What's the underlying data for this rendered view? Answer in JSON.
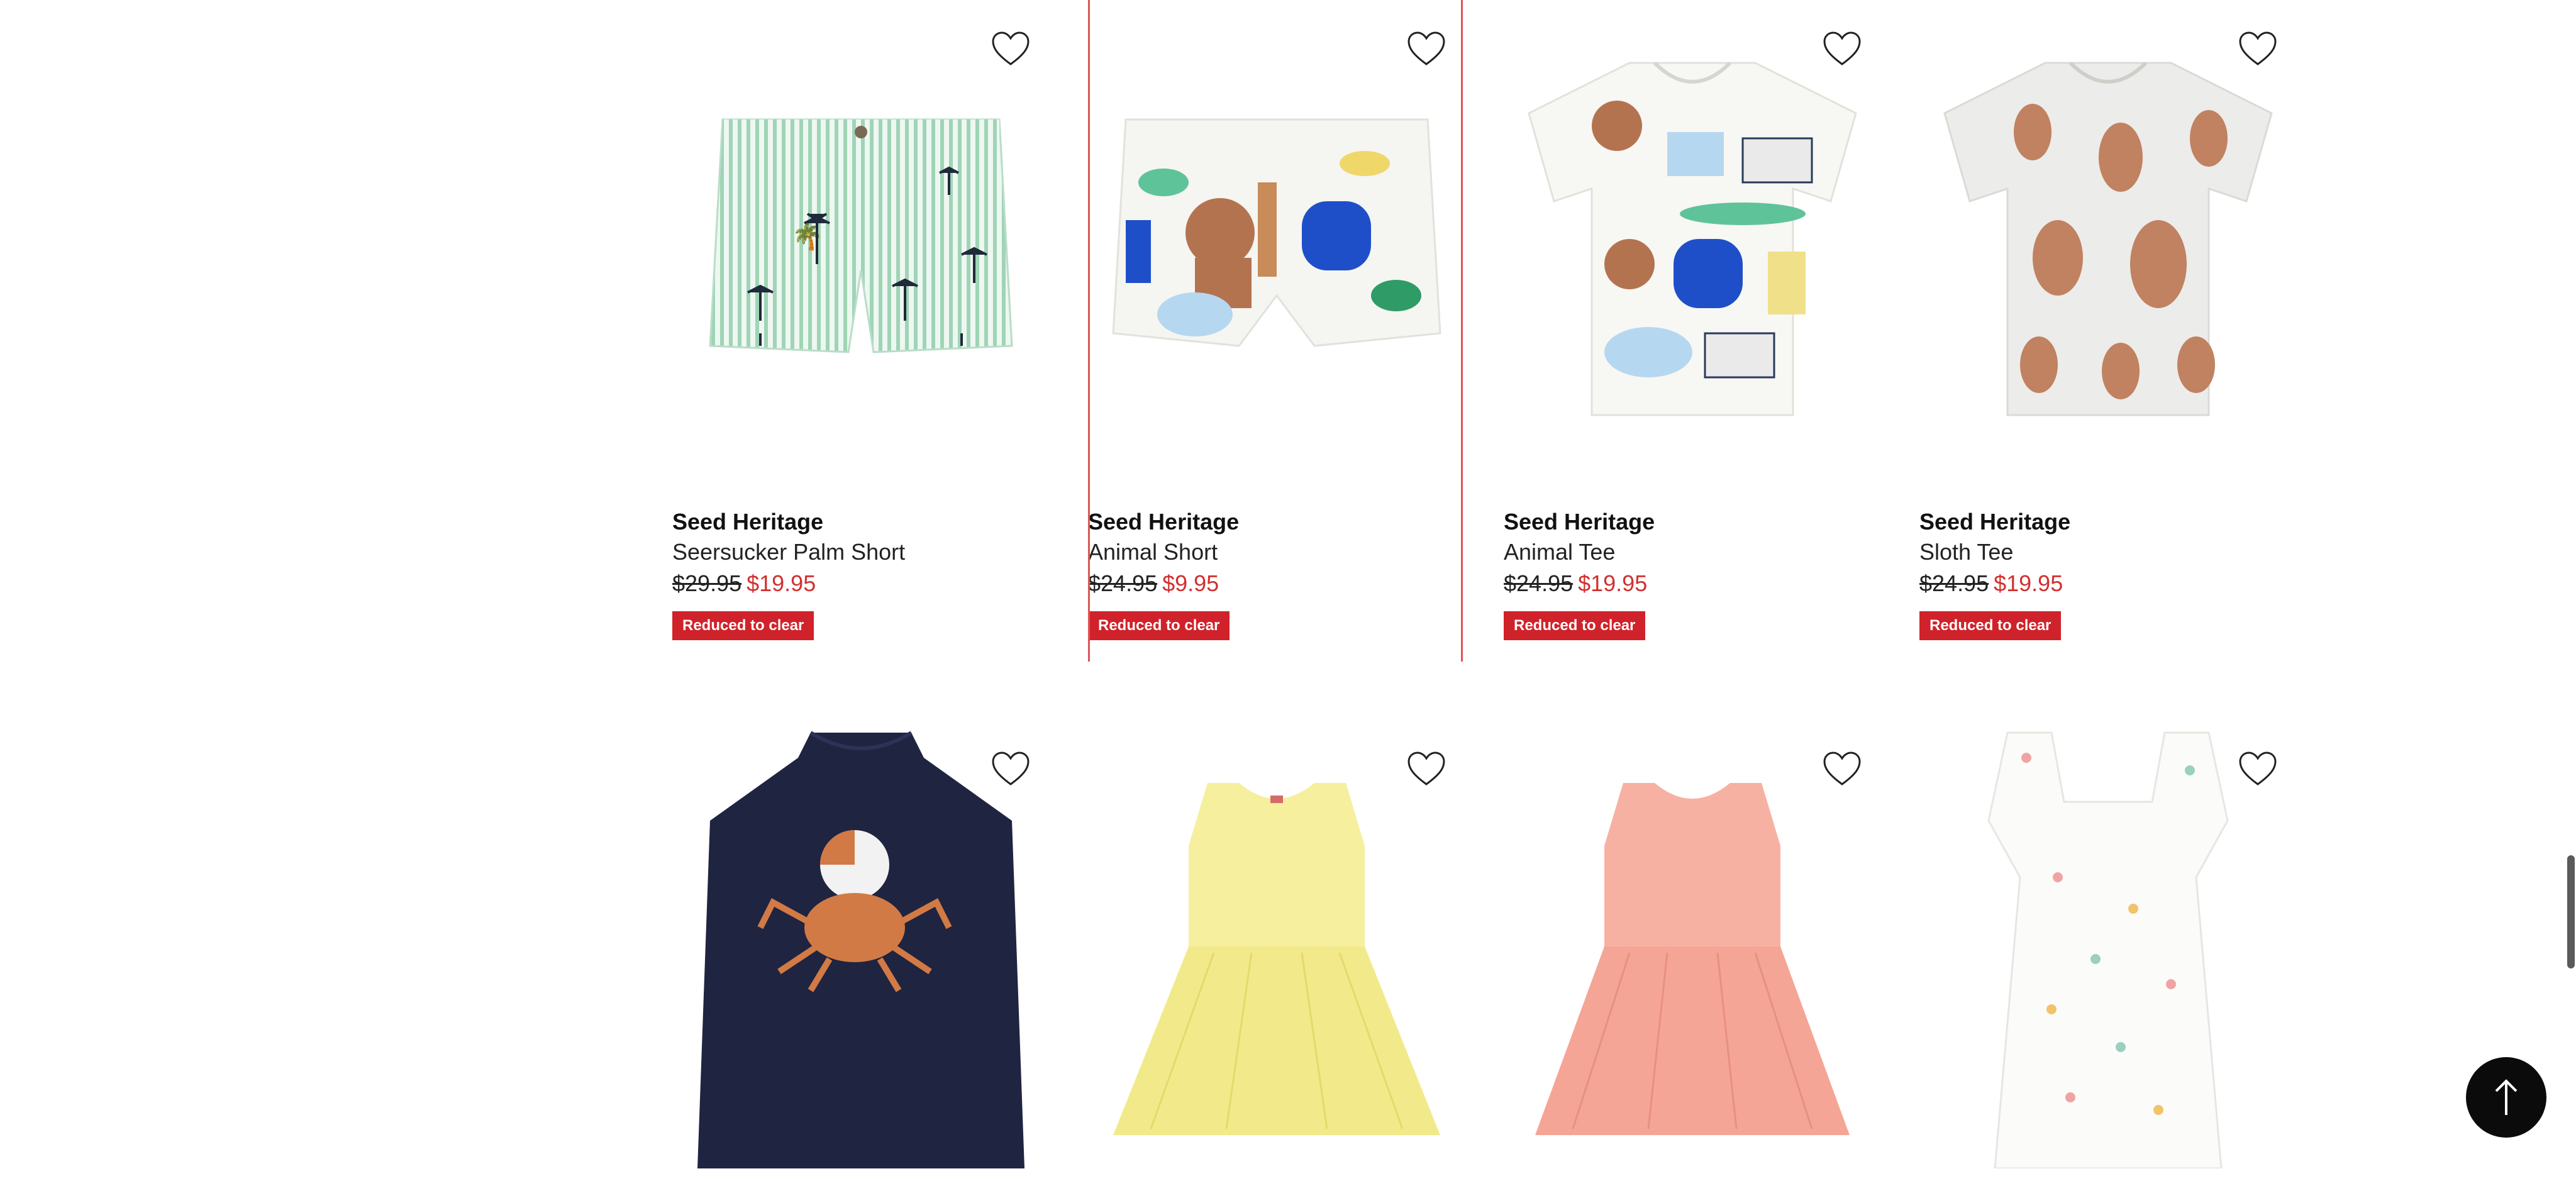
{
  "products": [
    {
      "brand": "Seed Heritage",
      "name": "Seersucker Palm Short",
      "was": "$29.95",
      "now": "$19.95",
      "badge": "Reduced to clear",
      "icon": "seersucker-short-image"
    },
    {
      "brand": "Seed Heritage",
      "name": "Animal Short",
      "was": "$24.95",
      "now": "$9.95",
      "badge": "Reduced to clear",
      "icon": "animal-short-image"
    },
    {
      "brand": "Seed Heritage",
      "name": "Animal Tee",
      "was": "$24.95",
      "now": "$19.95",
      "badge": "Reduced to clear",
      "icon": "animal-tee-image"
    },
    {
      "brand": "Seed Heritage",
      "name": "Sloth Tee",
      "was": "$24.95",
      "now": "$19.95",
      "badge": "Reduced to clear",
      "icon": "sloth-tee-image"
    },
    {
      "icon": "crab-swimsuit-image"
    },
    {
      "icon": "yellow-tulle-dress-image"
    },
    {
      "icon": "pink-tulle-dress-image"
    },
    {
      "icon": "floral-romper-image"
    }
  ],
  "colors": {
    "sale_red": "#d0222a",
    "price_red": "#d22f2f",
    "highlight": "#e05454",
    "navy": "#1f2440"
  },
  "icons": {
    "wishlist": "heart-icon",
    "back_to_top": "arrow-up-icon"
  }
}
